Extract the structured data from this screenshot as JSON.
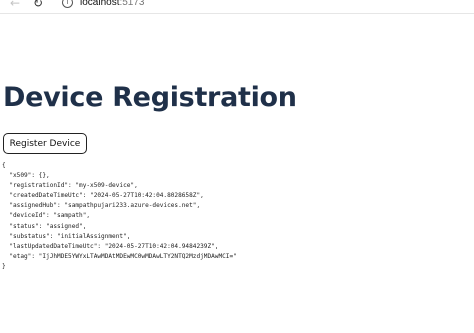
{
  "browser": {
    "back_icon": "arrow-left-icon",
    "reload_icon": "reload-icon",
    "info_icon": "info-icon",
    "url_host": "localhost",
    "url_port": ":5173"
  },
  "page": {
    "title": "Device Registration",
    "register_button_label": "Register Device",
    "result_json": "{\n  \"x509\": {},\n  \"registrationId\": \"my-x509-device\",\n  \"createdDateTimeUtc\": \"2024-05-27T10:42:04.8028658Z\",\n  \"assignedHub\": \"sampathpujari233.azure-devices.net\",\n  \"deviceId\": \"sampath\",\n  \"status\": \"assigned\",\n  \"substatus\": \"initialAssignment\",\n  \"lastUpdatedDateTimeUtc\": \"2024-05-27T10:42:04.9484239Z\",\n  \"etag\": \"IjJhMDE5YWYxLTAwMDAtMDEwMC0wMDAwLTY2NTQ2MzdjMDAwMCI=\"\n}"
  },
  "colors": {
    "heading": "#1f3049",
    "button_border": "#222222",
    "text": "#222222"
  }
}
